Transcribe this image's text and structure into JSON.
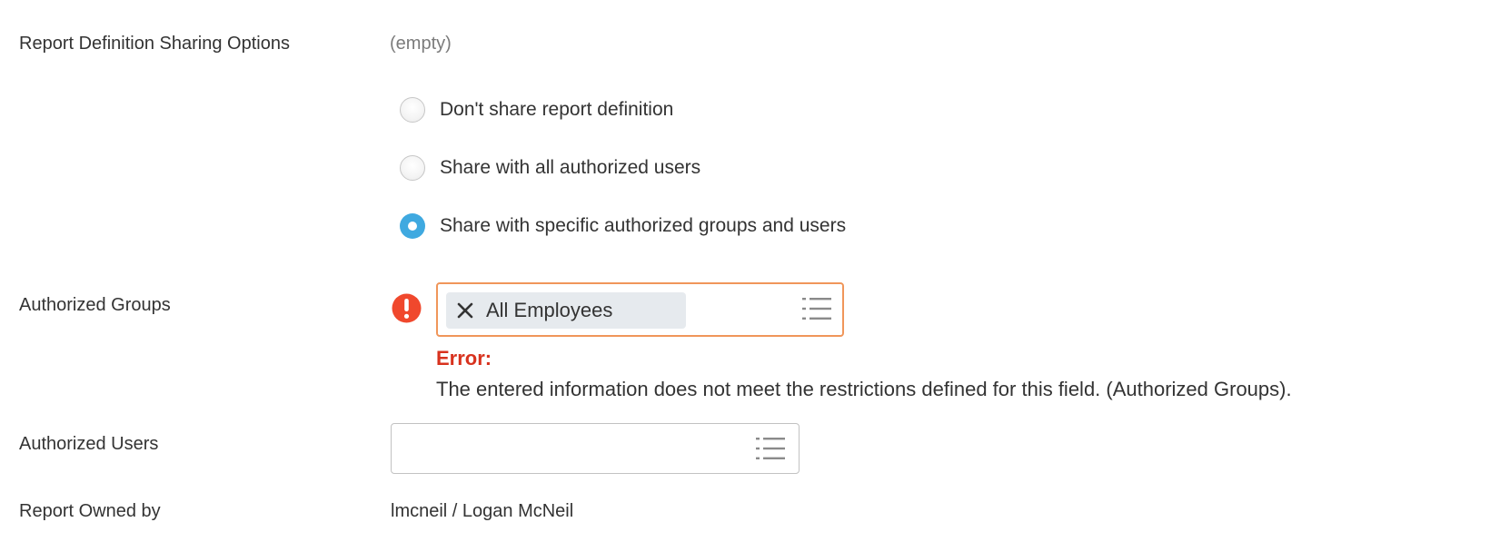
{
  "sharing": {
    "label": "Report Definition Sharing Options",
    "value": "(empty)",
    "options": [
      {
        "label": "Don't share report definition",
        "checked": false
      },
      {
        "label": "Share with all authorized users",
        "checked": false
      },
      {
        "label": "Share with specific authorized groups and users",
        "checked": true
      }
    ]
  },
  "authorized_groups": {
    "label": "Authorized Groups",
    "selected": [
      "All Employees"
    ],
    "error_title": "Error:",
    "error_message": "The entered information does not meet the restrictions defined for this field. (Authorized Groups).",
    "icon": "error-exclamation-icon"
  },
  "authorized_users": {
    "label": "Authorized Users",
    "value": ""
  },
  "report_owner": {
    "label": "Report Owned by",
    "value": "lmcneil / Logan McNeil"
  },
  "colors": {
    "radio_selected": "#3fa9e0",
    "error_red": "#d8321e",
    "error_border": "#f0965a",
    "error_icon": "#f0482d",
    "pill_background": "#e6eaee"
  }
}
